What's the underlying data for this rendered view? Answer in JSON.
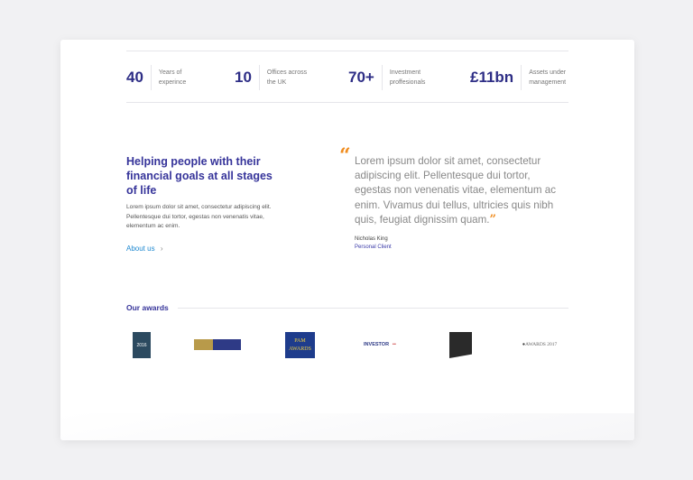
{
  "stats": [
    {
      "value": "40",
      "label": "Years of experince"
    },
    {
      "value": "10",
      "label": "Offices across the UK"
    },
    {
      "value": "70+",
      "label": "Investment proffesionals"
    },
    {
      "value": "£11bn",
      "label": "Assets under management"
    }
  ],
  "intro": {
    "heading": "Helping people with their financial goals at all stages of life",
    "body": "Lorem ipsum dolor sit amet, consectetur adipiscing elit. Pellentesque dui tortor, egestas non venenatis vitae, elementum ac enim.",
    "link": "About us",
    "link_chevron": "›"
  },
  "testimonial": {
    "open_quote": "“",
    "quote": "Lorem ipsum dolor sit amet, consectetur adipiscing elit. Pellentesque dui tortor, egestas non venenatis vitae, elementum ac enim. Vivamus dui tellus, ultricies quis nibh quis, feugiat dignissim quam.",
    "close_quote": "”",
    "author": "Nicholas King",
    "role": "Personal Client"
  },
  "awards": {
    "heading": "Our awards",
    "logos": [
      {
        "name": "award-2016-logo",
        "text": "2016"
      },
      {
        "name": "award-banner-logo",
        "text": ""
      },
      {
        "name": "pam-awards-logo",
        "text": "PAM AWARDS"
      },
      {
        "name": "growth-investor-logo",
        "text": "INVESTOR"
      },
      {
        "name": "moneyfacts-logo",
        "text": ""
      },
      {
        "name": "wealth-awards-logo",
        "text": "AWARDS 2017"
      }
    ]
  },
  "colors": {
    "primary": "#36349a",
    "accent": "#f08c1e",
    "link": "#1e88d0"
  }
}
